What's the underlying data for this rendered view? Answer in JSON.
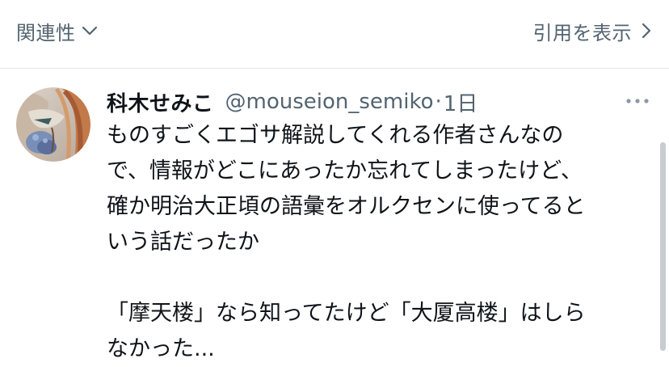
{
  "topbar": {
    "sort_label": "関連性",
    "quotes_label": "引用を表示"
  },
  "icons": {
    "sort": "chevron-down-icon",
    "quotes": "chevron-right-icon",
    "more": "more-horizontal-icon"
  },
  "tweet": {
    "display_name": "科木せみこ",
    "handle": "@mouseion_semiko",
    "separator": "·",
    "timestamp": "1日",
    "lines": [
      "ものすごくエゴサ解説してくれる作者さんなの",
      "で、情報がどこにあったか忘れてしまったけど、",
      "確か明治大正頃の語彙をオルクセンに使ってると",
      "いう話だったか"
    ],
    "lines2": [
      "「摩天楼」なら知ってたけど「大厦高楼」はしら",
      "なかった..."
    ]
  },
  "colors": {
    "secondary_text": "#536471",
    "primary_text": "#0f1419",
    "divider": "#e6e8eb"
  }
}
